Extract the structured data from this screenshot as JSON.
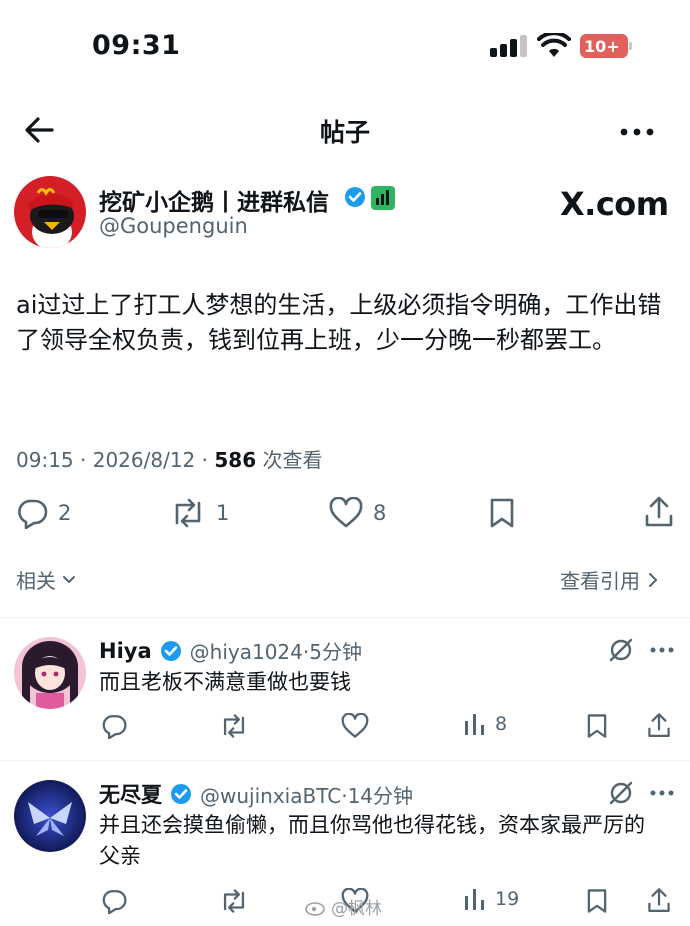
{
  "status_bar": {
    "time": "09:31",
    "battery": "10+"
  },
  "header": {
    "title": "帖子"
  },
  "post": {
    "author_name": "挖矿小企鹅丨进群私信",
    "author_handle": "@Goupenguin",
    "source_logo": "X.com",
    "text": "ai过过上了打工人梦想的生活，上级必须指令明确，工作出错了领导全权负责，钱到位再上班，少一分晚一秒都罢工。",
    "time": "09:15",
    "date": "2026/8/12",
    "views": "586",
    "views_label": "次查看",
    "reply_count": "2",
    "repost_count": "1",
    "like_count": "8"
  },
  "related_label": "相关",
  "view_quotes_label": "查看引用",
  "replies": [
    {
      "name": "Hiya",
      "handle": "@hiya1024",
      "time": "5分钟",
      "text": "而且老板不满意重做也要钱",
      "views": "8"
    },
    {
      "name": "无尽夏",
      "handle": "@wujinxiaBTC",
      "time": "14分钟",
      "text": "并且还会摸鱼偷懒，而且你骂他也得花钱，资本家最严厉的父亲",
      "views": "19"
    }
  ],
  "watermark": "@枫林",
  "colors": {
    "verified": "#1d9bf0",
    "text": "#0f1419",
    "muted": "#536471",
    "battery": "#e0605c",
    "badge_green": "#2fb463"
  },
  "icons": [
    "back-arrow-icon",
    "more-icon",
    "verified-icon",
    "reply-icon",
    "repost-icon",
    "like-icon",
    "bookmark-icon",
    "share-icon",
    "chevron-down-icon",
    "chevron-right-icon",
    "grok-icon",
    "views-icon"
  ]
}
